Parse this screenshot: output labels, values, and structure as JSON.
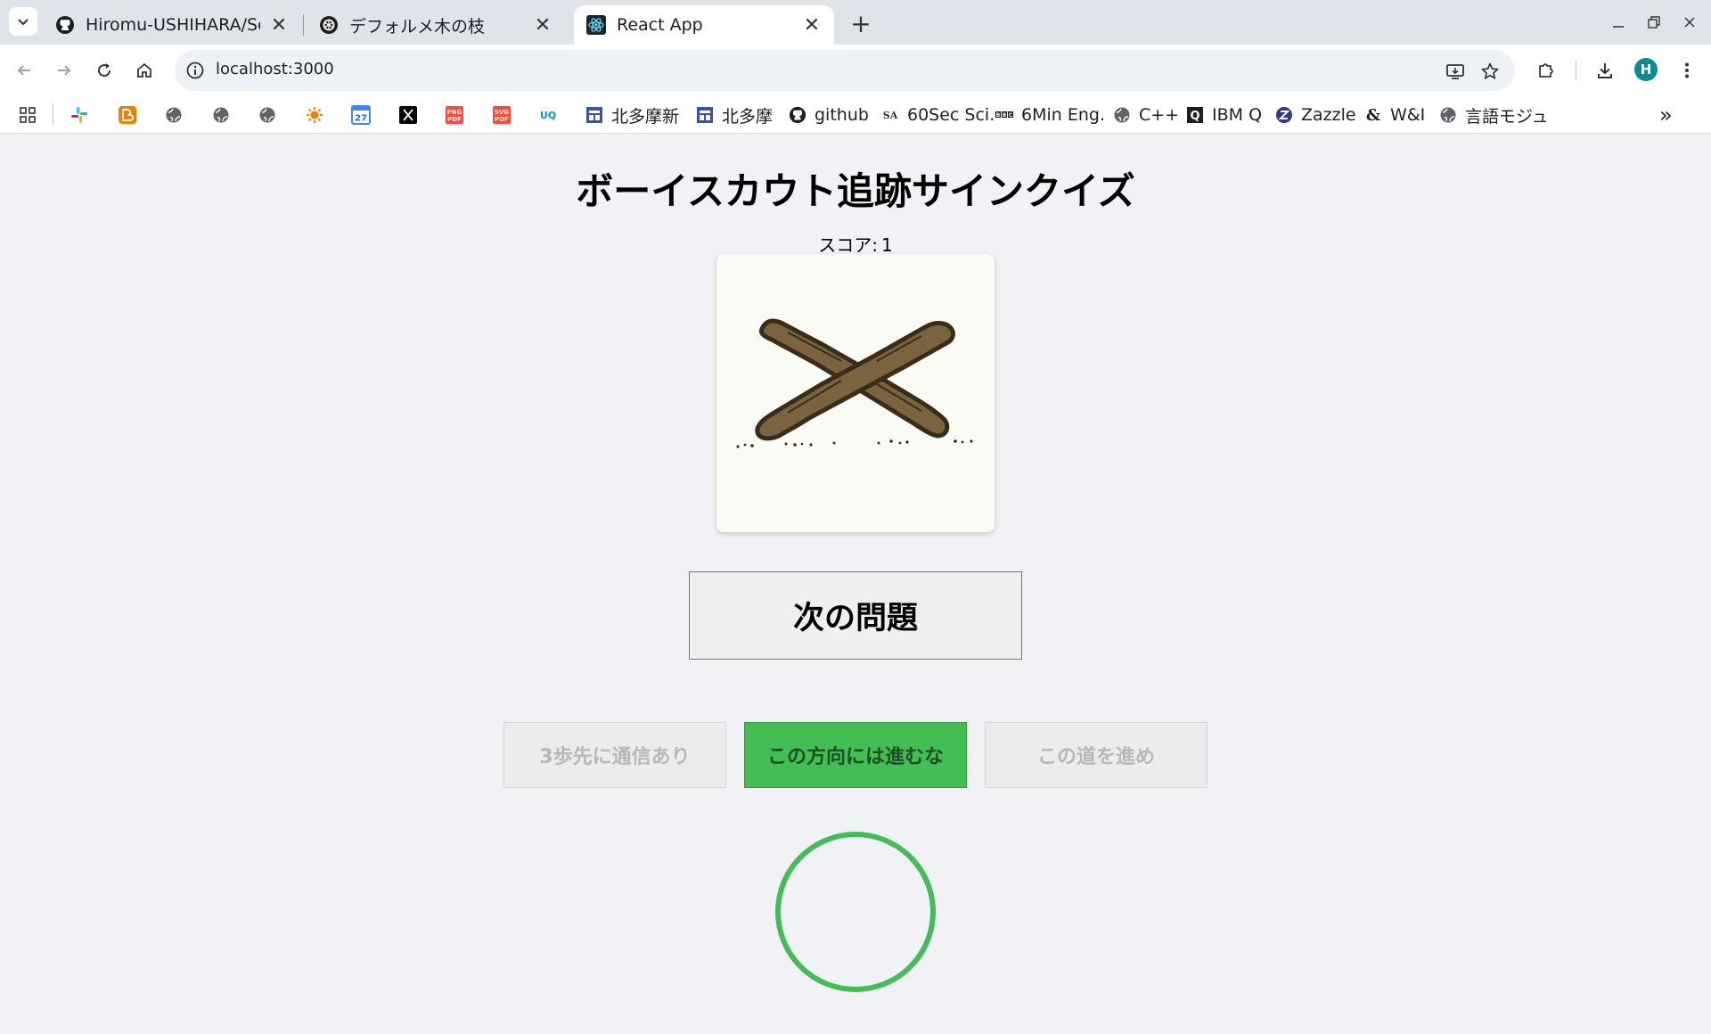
{
  "browser": {
    "tabs": [
      {
        "title": "Hiromu-USHIHARA/Scout",
        "icon": "github-icon",
        "active": false
      },
      {
        "title": "デフォルメ木の枝",
        "icon": "openai-icon",
        "active": false
      },
      {
        "title": "React App",
        "icon": "react-icon",
        "active": true
      }
    ],
    "close_glyph": "✕",
    "new_tab_glyph": "+",
    "url": "localhost:3000",
    "profile_initial": "H"
  },
  "bookmarks": [
    {
      "label": "",
      "icon": "apps-grid-icon"
    },
    {
      "label": "",
      "icon": "slack-icon"
    },
    {
      "label": "",
      "icon": "blogger-icon"
    },
    {
      "label": "",
      "icon": "globe-icon"
    },
    {
      "label": "",
      "icon": "globe-icon"
    },
    {
      "label": "",
      "icon": "globe-icon"
    },
    {
      "label": "",
      "icon": "sun-icon"
    },
    {
      "label": "",
      "icon": "calendar-icon",
      "text": "27"
    },
    {
      "label": "",
      "icon": "x-icon"
    },
    {
      "label": "",
      "icon": "png-pdf-icon",
      "text": "PNG PDF"
    },
    {
      "label": "",
      "icon": "svg-pdf-icon",
      "text": "SVG PDF"
    },
    {
      "label": "",
      "icon": "uq-icon",
      "text": "UQ"
    },
    {
      "label": "北多摩新",
      "icon": "site-icon"
    },
    {
      "label": "北多摩",
      "icon": "site-icon"
    },
    {
      "label": "github",
      "icon": "github-icon"
    },
    {
      "label": "60Sec Sci.",
      "icon": "sa-icon",
      "text": "SA"
    },
    {
      "label": "6Min Eng.",
      "icon": "bbc-icon",
      "text": "BBC"
    },
    {
      "label": "C++",
      "icon": "globe-icon"
    },
    {
      "label": "IBM Q",
      "icon": "ibmq-icon",
      "text": "Q"
    },
    {
      "label": "Zazzle",
      "icon": "zazzle-icon",
      "text": "Z"
    },
    {
      "label": "W&I",
      "icon": "ampersand-icon",
      "text": "&"
    },
    {
      "label": "言語モジュ",
      "icon": "globe-icon"
    }
  ],
  "bookmarks_overflow": "»",
  "app": {
    "title": "ボーイスカウト追跡サインクイズ",
    "score_label": "スコア:",
    "score_value": "1",
    "next_button": "次の問題",
    "choices": [
      {
        "label": "3歩先に通信あり",
        "state": "disabled"
      },
      {
        "label": "この方向には進むな",
        "state": "correct"
      },
      {
        "label": "この道を進め",
        "state": "disabled"
      }
    ],
    "result": "correct-circle"
  },
  "colors": {
    "correct": "#43bd54",
    "page_bg": "#f0f2f5",
    "tabstrip_bg": "#dfe3ea",
    "stick_fill": "#7a6440",
    "stick_outline": "#3a2c17"
  }
}
